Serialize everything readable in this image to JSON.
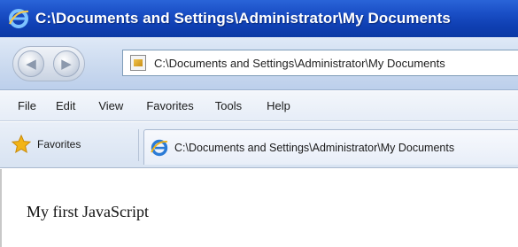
{
  "window": {
    "title": "C:\\Documents and Settings\\Administrator\\My Documents",
    "app_icon": "ie-logo-icon"
  },
  "navigation": {
    "back_icon": "back-arrow-icon",
    "forward_icon": "forward-arrow-icon",
    "address": "C:\\Documents and Settings\\Administrator\\My Documents"
  },
  "menu": {
    "items": [
      {
        "label": "File"
      },
      {
        "label": "Edit"
      },
      {
        "label": "View"
      },
      {
        "label": "Favorites"
      },
      {
        "label": "Tools"
      },
      {
        "label": "Help"
      }
    ]
  },
  "favorites_bar": {
    "favorites_label": "Favorites",
    "star_icon": "favorites-star-icon",
    "tab_title": "C:\\Documents and Settings\\Administrator\\My Documents"
  },
  "page": {
    "text": "My first JavaScript"
  },
  "colors": {
    "titlebar": "#1a4fc6",
    "toolbar": "#d5e1f2"
  }
}
